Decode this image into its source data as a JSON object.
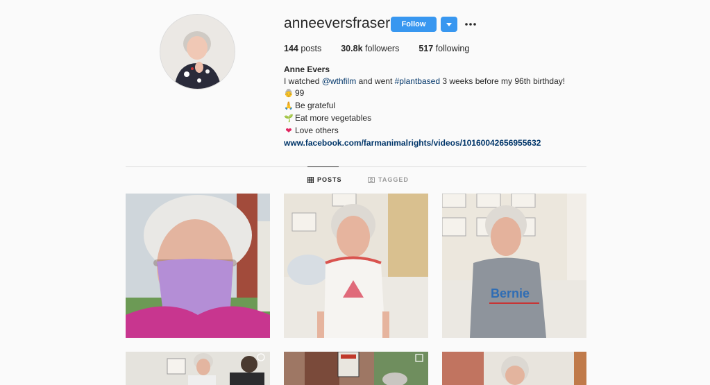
{
  "profile": {
    "username": "anneeversfraser",
    "follow_label": "Follow",
    "dropdown_icon": "caret-down-icon",
    "more_icon": "more-options-icon"
  },
  "stats": {
    "posts_count": "144",
    "posts_label": "posts",
    "followers_count": "30.8k",
    "followers_label": "followers",
    "following_count": "517",
    "following_label": "following"
  },
  "bio": {
    "name": "Anne Evers",
    "line1_prefix": "I watched ",
    "line1_mention": "@wthfilm",
    "line1_middle": " and went ",
    "line1_hashtag": "#plantbased",
    "line1_suffix": " 3 weeks before my 96th birthday!",
    "line2": "99",
    "line3": "Be grateful",
    "line4": "Eat more vegetables",
    "line5": "Love others",
    "link": "www.facebook.com/farmanimalrights/videos/10160042656955632"
  },
  "tabs": {
    "posts_label": "POSTS",
    "tagged_label": "TAGGED"
  },
  "colors": {
    "accent": "#3897f0",
    "link": "#003569",
    "background": "#fafafa"
  }
}
